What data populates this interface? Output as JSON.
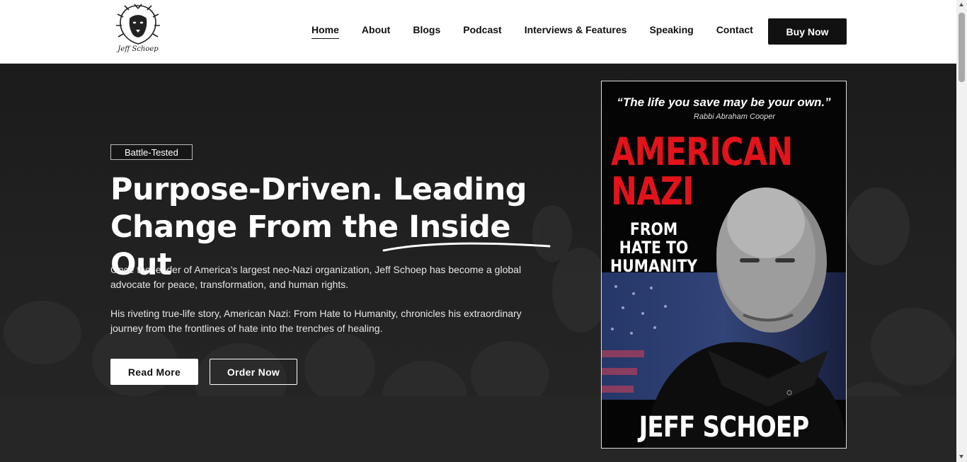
{
  "header": {
    "logo_text": "Jeff Schoep",
    "nav": [
      {
        "label": "Home",
        "active": true
      },
      {
        "label": "About",
        "active": false
      },
      {
        "label": "Blogs",
        "active": false
      },
      {
        "label": "Podcast",
        "active": false
      },
      {
        "label": "Interviews & Features",
        "active": false
      },
      {
        "label": "Speaking",
        "active": false
      },
      {
        "label": "Contact",
        "active": false
      }
    ],
    "buy_label": "Buy Now"
  },
  "hero": {
    "badge": "Battle-Tested",
    "headline_line1": "Purpose-Driven. Leading",
    "headline_line2_prefix": "Change From the ",
    "headline_line2_emphasis": "Inside Out",
    "para1": "Once the leader of America’s largest neo-Nazi organization, Jeff Schoep has become a global advocate for peace, transformation, and human rights.",
    "para2": "His riveting true-life story, American Nazi: From Hate to Humanity, chronicles his extraordinary journey from the frontlines of hate into the trenches of healing.",
    "read_more_label": "Read More",
    "order_now_label": "Order Now"
  },
  "book": {
    "quote": "“The life you save may be your own.”",
    "quote_by": "Rabbi Abraham Cooper",
    "title_line1": "AMERICAN",
    "title_line2": "NAZI",
    "subtitle_line1": "FROM",
    "subtitle_line2": "HATE TO",
    "subtitle_line3": "HUMANITY",
    "author": "JEFF SCHOEP"
  },
  "colors": {
    "accent_red": "#e2131b",
    "dark": "#111111",
    "hero_bg": "#1f1f1f"
  }
}
